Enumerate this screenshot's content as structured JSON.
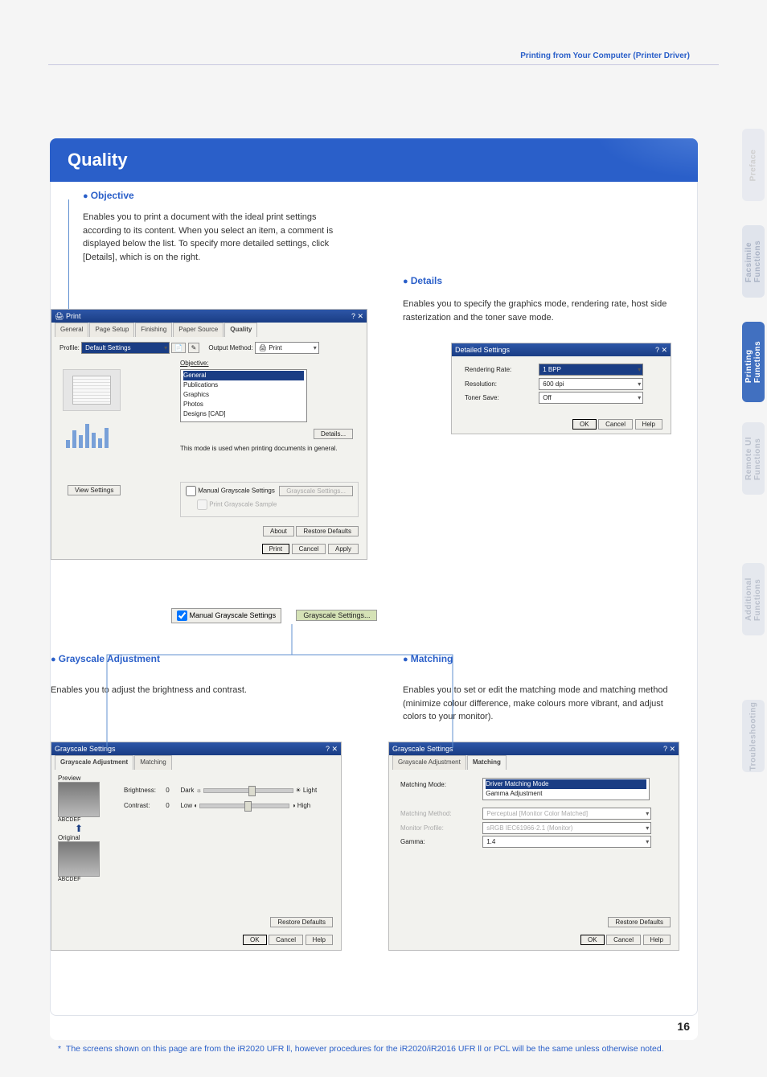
{
  "breadcrumb": "Printing from Your Computer (Printer Driver)",
  "side_tabs": {
    "preface": "Preface",
    "facsimile": "Facsimile\nFunctions",
    "printing": "Printing\nFunctions",
    "remote": "Remote UI\nFunctions",
    "additional": "Additional\nFunctions",
    "troubleshooting": "Troubleshooting"
  },
  "title": "Quality",
  "page_number": "16",
  "footnote": "The screens shown on this page are from the iR2020 UFR ll, however procedures for the iR2020/iR2016 UFR ll or PCL will be the same unless otherwise noted.",
  "objective": {
    "heading": "Objective",
    "body": "Enables you to print a document with the ideal print settings according to its content. When you select an item, a comment is displayed below the list. To specify more detailed settings, click [Details], which is on the right."
  },
  "details": {
    "heading": "Details",
    "body": "Enables you to specify the graphics mode, rendering rate, host side rasterization and the toner save mode."
  },
  "grayscale_adjustment": {
    "heading": "Grayscale Adjustment",
    "body": "Enables you to adjust the brightness and contrast."
  },
  "matching": {
    "heading": "Matching",
    "body": "Enables you to set or edit the matching mode and matching method (minimize colour difference, make colours more vibrant, and adjust colors to your monitor)."
  },
  "quality_dialog": {
    "window_title": "Print",
    "tabs": [
      "General",
      "Page Setup",
      "Finishing",
      "Paper Source",
      "Quality"
    ],
    "active_tab": "Quality",
    "profile_label": "Profile:",
    "profile_value": "Default Settings",
    "output_method_label": "Output Method:",
    "output_method_value": "Print",
    "objective_label": "Objective:",
    "objective_items": [
      "General",
      "Publications",
      "Graphics",
      "Photos",
      "Designs [CAD]"
    ],
    "objective_selected": "General",
    "details_button": "Details...",
    "note_text": "This mode is used when printing documents in general.",
    "view_settings": "View Settings",
    "manual_grayscale": "Manual Grayscale Settings",
    "grayscale_settings_btn": "Grayscale Settings...",
    "print_grayscale_sample": "Print Grayscale Sample",
    "about": "About",
    "restore_defaults": "Restore Defaults",
    "print": "Print",
    "cancel": "Cancel",
    "apply": "Apply",
    "chk_label": "Manual Grayscale Settings"
  },
  "details_dialog": {
    "window_title": "Detailed Settings",
    "rendering_rate_label": "Rendering Rate:",
    "rendering_rate_value": "1 BPP",
    "resolution_label": "Resolution:",
    "resolution_value": "600 dpi",
    "toner_save_label": "Toner Save:",
    "toner_save_value": "Off",
    "ok": "OK",
    "cancel": "Cancel",
    "help": "Help"
  },
  "grayscale_dialog": {
    "window_title": "Grayscale Settings",
    "tabs": [
      "Grayscale Adjustment",
      "Matching"
    ],
    "active_tab": "Grayscale Adjustment",
    "preview_label": "Preview",
    "brightness_label": "Brightness:",
    "brightness_value": "0",
    "brightness_dark": "Dark",
    "brightness_light": "Light",
    "contrast_label": "Contrast:",
    "contrast_value": "0",
    "contrast_low": "Low",
    "contrast_high": "High",
    "sample_caption_top": "ABCDEF",
    "original_label": "Original",
    "sample_caption_bottom": "ABCDEF",
    "restore_defaults": "Restore Defaults",
    "ok": "OK",
    "cancel": "Cancel",
    "help": "Help"
  },
  "matching_dialog": {
    "window_title": "Grayscale Settings",
    "tabs": [
      "Grayscale Adjustment",
      "Matching"
    ],
    "active_tab": "Matching",
    "matching_mode_label": "Matching Mode:",
    "matching_mode_items": [
      "Driver Matching Mode",
      "Gamma Adjustment"
    ],
    "matching_mode_selected": "Driver Matching Mode",
    "matching_method_label": "Matching Method:",
    "matching_method_value": "Perceptual [Monitor Color Matched]",
    "monitor_profile_label": "Monitor Profile:",
    "monitor_profile_value": "sRGB IEC61966-2.1 (Monitor)",
    "gamma_label": "Gamma:",
    "gamma_value": "1.4",
    "restore_defaults": "Restore Defaults",
    "ok": "OK",
    "cancel": "Cancel",
    "help": "Help"
  },
  "callout_chk": "Manual Grayscale Settings",
  "callout_btn": "Grayscale Settings..."
}
